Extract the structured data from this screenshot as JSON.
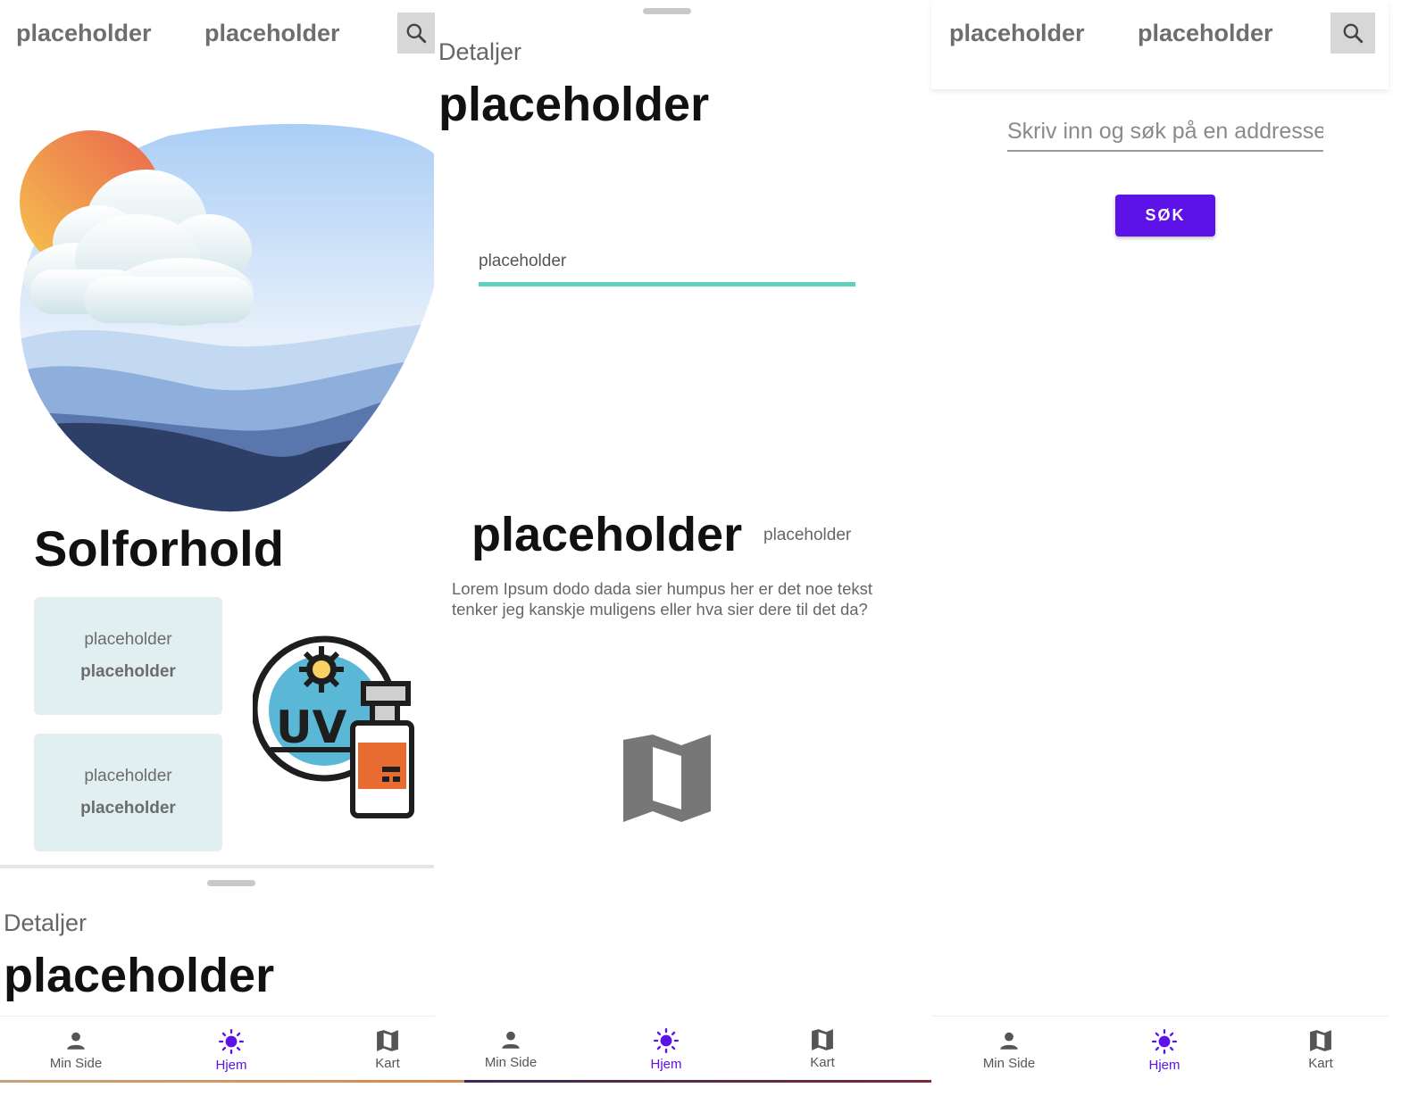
{
  "screen1": {
    "topbar": {
      "tab1": "placeholder",
      "tab2": "placeholder"
    },
    "title": "Solforhold",
    "cards": [
      {
        "line1": "placeholder",
        "line2": "placeholder"
      },
      {
        "line1": "placeholder",
        "line2": "placeholder"
      }
    ],
    "sheet": {
      "label": "Detaljer",
      "title": "placeholder"
    }
  },
  "screen2": {
    "sheet_label": "Detaljer",
    "sheet_title": "placeholder",
    "field_placeholder": "placeholder",
    "big_title": "placeholder",
    "small_label": "placeholder",
    "lorem": "Lorem Ipsum dodo dada sier humpus her er det noe tekst tenker jeg kanskje muligens eller hva sier dere til det da?"
  },
  "screen3": {
    "topbar": {
      "tab1": "placeholder",
      "tab2": "placeholder"
    },
    "search_placeholder": "Skriv inn og søk på en addresse",
    "search_button": "SØK"
  },
  "nav": {
    "items": [
      {
        "label": "Min Side",
        "icon": "person-icon"
      },
      {
        "label": "Hjem",
        "icon": "sun-icon",
        "active": true
      },
      {
        "label": "Kart",
        "icon": "map-icon"
      }
    ]
  },
  "colors": {
    "accent": "#5d12e8",
    "field_underline": "#5fd1be",
    "card_bg": "#e2eff0"
  }
}
